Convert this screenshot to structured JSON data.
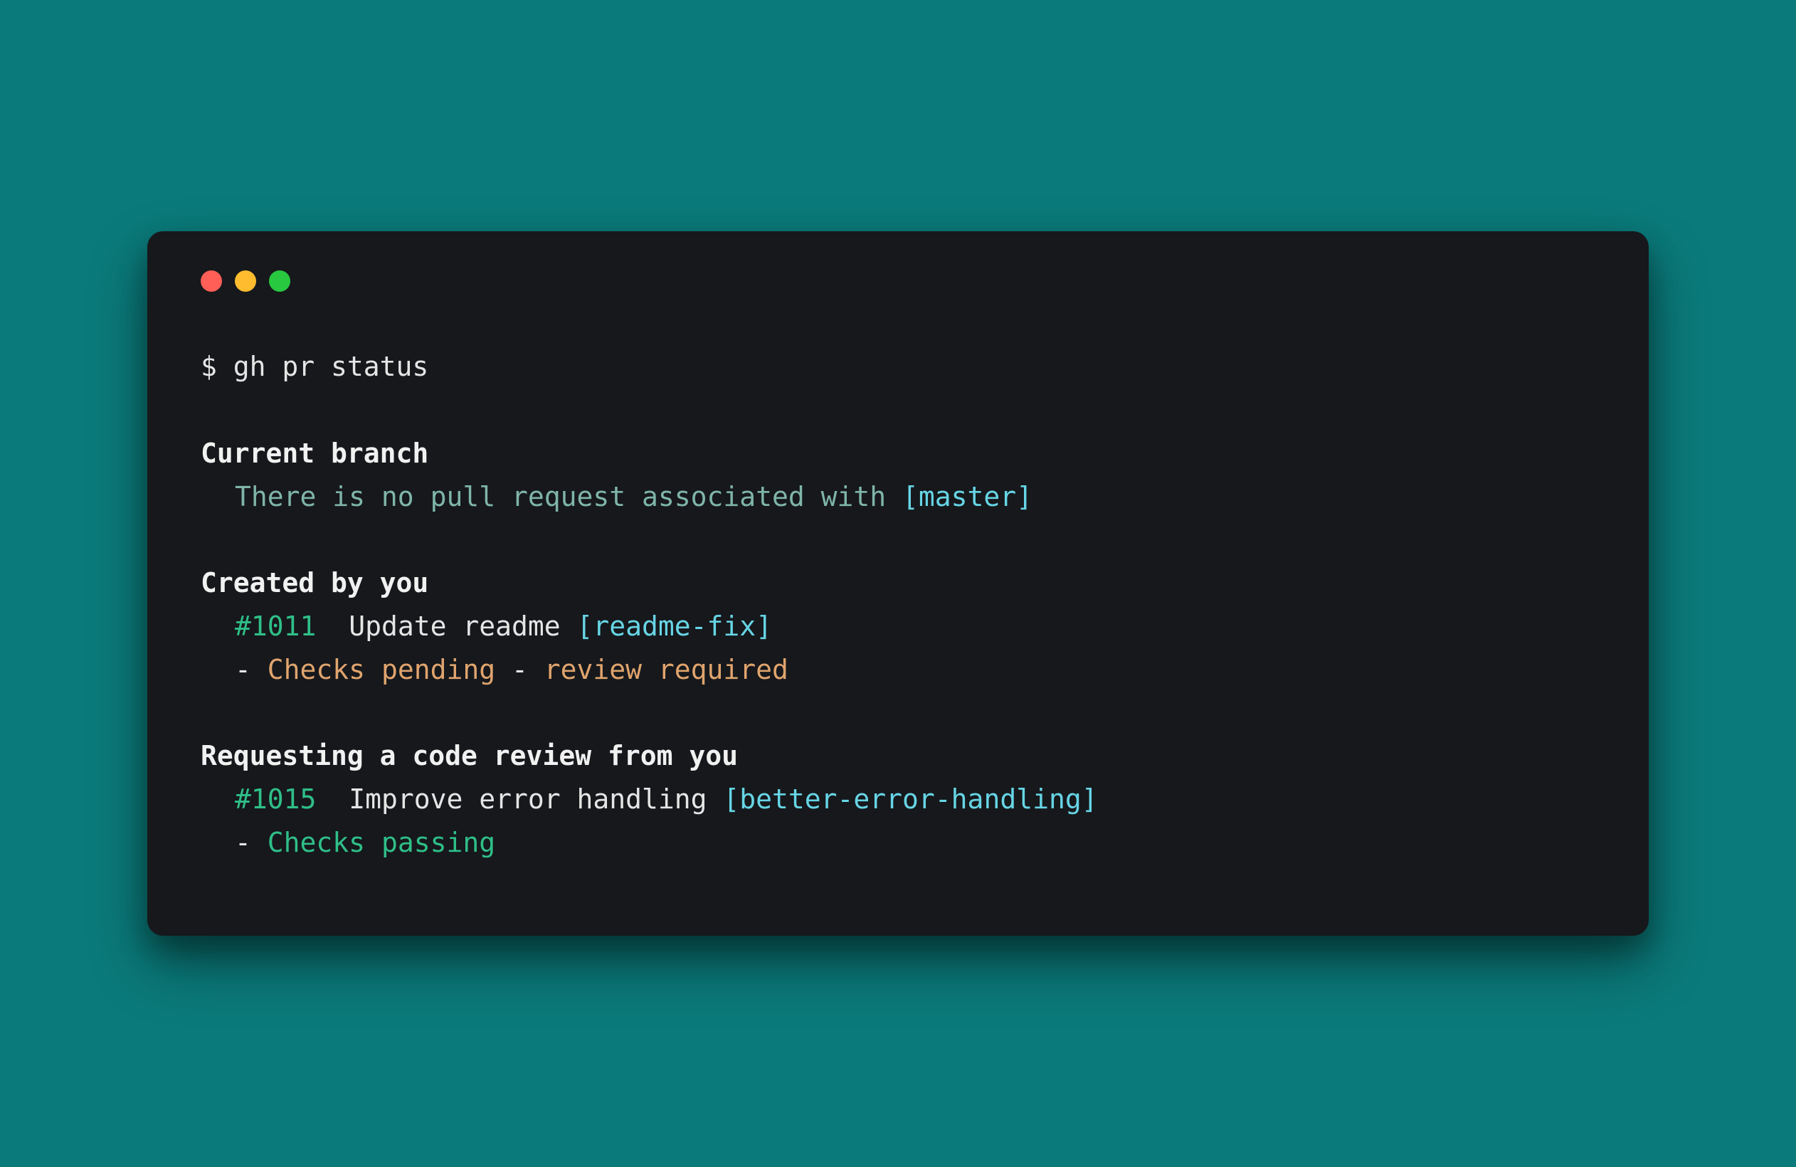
{
  "prompt": "$ ",
  "command": "gh pr status",
  "sections": {
    "current_branch": {
      "heading": "Current branch",
      "message_pre": "There is no pull request associated with ",
      "branch": "[master]"
    },
    "created_by_you": {
      "heading": "Created by you",
      "pr": {
        "number": "#1011",
        "gap": "  ",
        "title": "Update readme ",
        "branch": "[readme-fix]"
      },
      "status": {
        "bullet1": "- ",
        "checks": "Checks pending",
        "bullet2": " - ",
        "review": "review required"
      }
    },
    "requesting_review": {
      "heading": "Requesting a code review from you",
      "pr": {
        "number": "#1015",
        "gap": "  ",
        "title": "Improve error handling ",
        "branch": "[better-error-handling]"
      },
      "status": {
        "bullet1": "- ",
        "checks": "Checks passing"
      }
    }
  }
}
